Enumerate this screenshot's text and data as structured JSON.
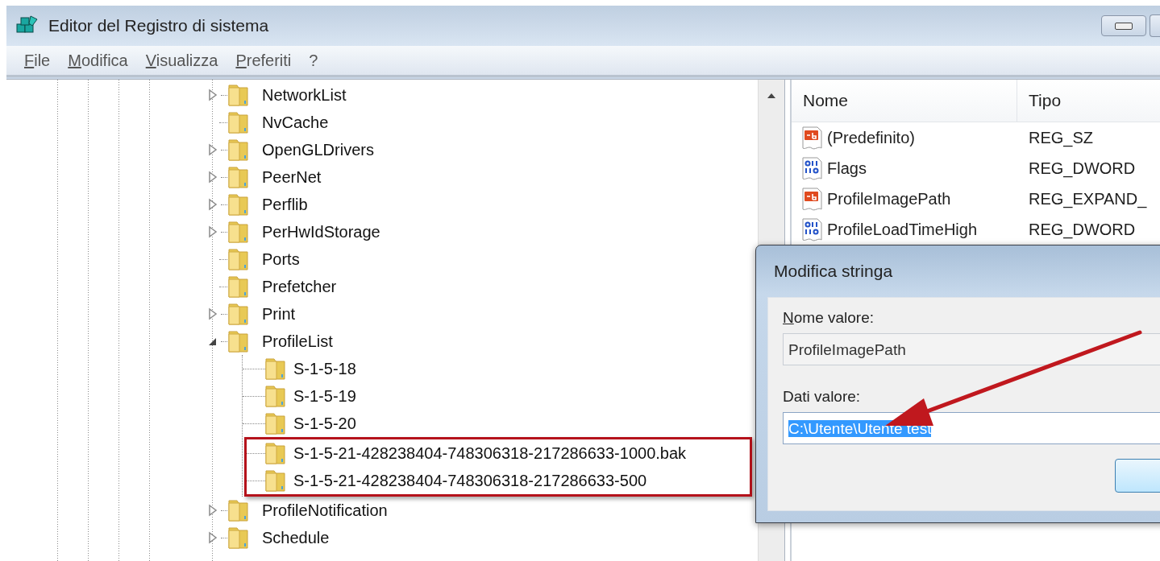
{
  "window": {
    "title": "Editor del Registro di sistema"
  },
  "menu": [
    "File",
    "Modifica",
    "Visualizza",
    "Preferiti",
    "?"
  ],
  "tree": {
    "items": [
      {
        "label": "NetworkList",
        "kind": "collapsed"
      },
      {
        "label": "NvCache",
        "kind": "leaf"
      },
      {
        "label": "OpenGLDrivers",
        "kind": "collapsed"
      },
      {
        "label": "PeerNet",
        "kind": "collapsed"
      },
      {
        "label": "Perflib",
        "kind": "collapsed"
      },
      {
        "label": "PerHwIdStorage",
        "kind": "collapsed"
      },
      {
        "label": "Ports",
        "kind": "leaf"
      },
      {
        "label": "Prefetcher",
        "kind": "leaf"
      },
      {
        "label": "Print",
        "kind": "collapsed"
      },
      {
        "label": "ProfileList",
        "kind": "expanded",
        "children": [
          {
            "label": "S-1-5-18",
            "highlighted": false
          },
          {
            "label": "S-1-5-19",
            "highlighted": false
          },
          {
            "label": "S-1-5-20",
            "highlighted": false
          },
          {
            "label": "S-1-5-21-428238404-748306318-217286633-1000.bak",
            "highlighted": true
          },
          {
            "label": "S-1-5-21-428238404-748306318-217286633-500",
            "highlighted": true
          }
        ]
      },
      {
        "label": "ProfileNotification",
        "kind": "collapsed"
      },
      {
        "label": "Schedule",
        "kind": "collapsed"
      }
    ]
  },
  "values": {
    "columns": [
      "Nome",
      "Tipo"
    ],
    "rows": [
      {
        "kind": "string",
        "name": "(Predefinito)",
        "type": "REG_SZ"
      },
      {
        "kind": "binary",
        "name": "Flags",
        "type": "REG_DWORD"
      },
      {
        "kind": "string",
        "name": "ProfileImagePath",
        "type": "REG_EXPAND_"
      },
      {
        "kind": "binary",
        "name": "ProfileLoadTimeHigh",
        "type": "REG_DWORD"
      }
    ]
  },
  "dialog": {
    "title": "Modifica stringa",
    "name_label": "Nome valore:",
    "name_value": "ProfileImagePath",
    "data_label": "Dati valore:",
    "data_value": "C:\\Utente\\Utente test",
    "data_value_selected": true,
    "arrow_annotation": true
  }
}
